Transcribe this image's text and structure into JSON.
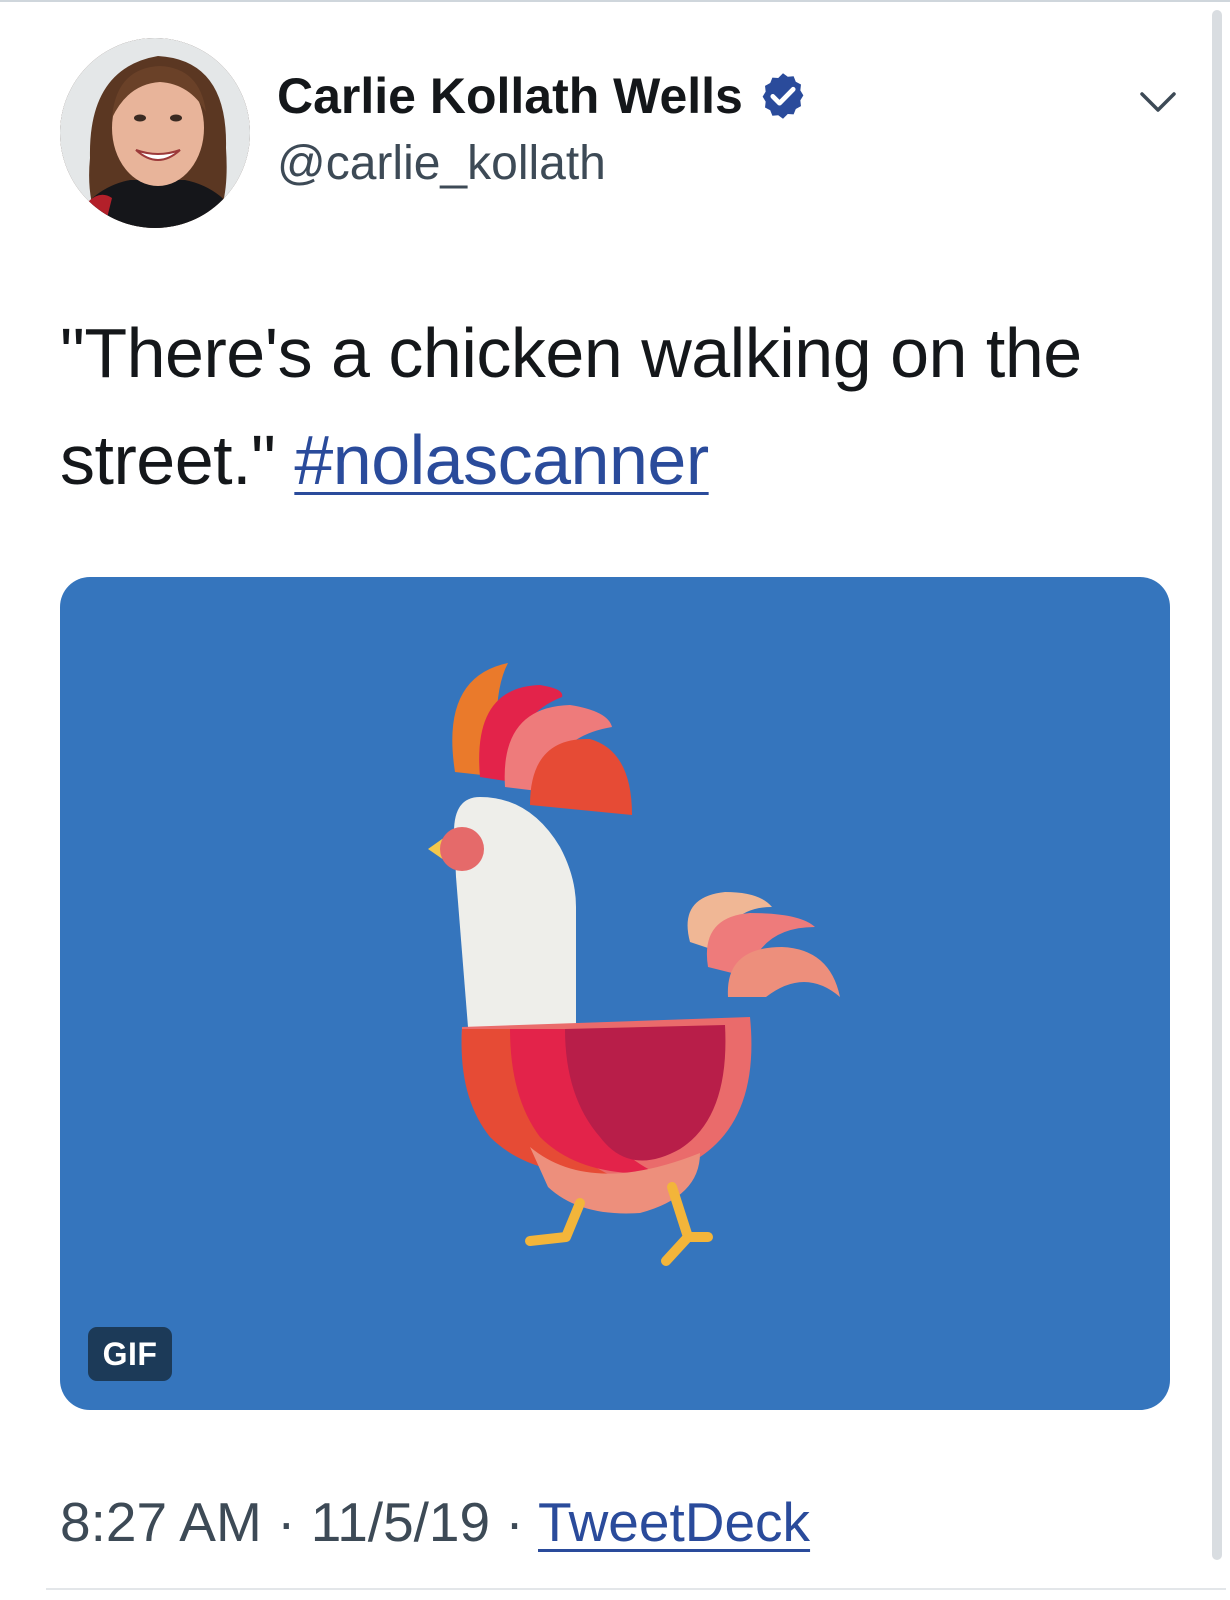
{
  "tweet": {
    "author": {
      "name": "Carlie Kollath Wells",
      "handle": "@carlie_kollath",
      "verified_icon": "verified-badge-icon"
    },
    "text": "\"There's a chicken walking on the street.\"",
    "hashtag": "#nolascanner",
    "media": {
      "type": "gif",
      "badge": "GIF",
      "background_color": "#3575bd",
      "subject_icon": "rooster-illustration"
    },
    "time": "8:27 AM",
    "separator": "·",
    "date": "11/5/19",
    "source": "TweetDeck",
    "menu_icon": "chevron-down-icon"
  },
  "colors": {
    "link": "#2a4b9b",
    "text": "#14171a",
    "secondary_text": "#3d4a56",
    "verified": "#2a4b9b"
  }
}
